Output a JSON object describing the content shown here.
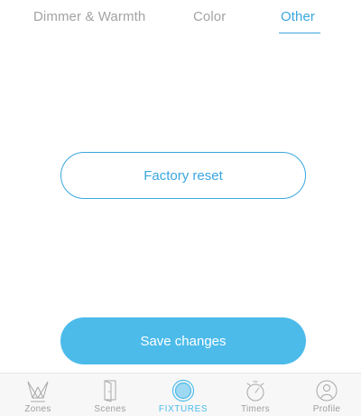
{
  "tabs": [
    {
      "label": "Dimmer & Warmth",
      "active": false
    },
    {
      "label": "Color",
      "active": false
    },
    {
      "label": "Other",
      "active": true
    }
  ],
  "actions": {
    "factory_reset_label": "Factory reset",
    "save_label": "Save changes"
  },
  "nav": {
    "items": [
      {
        "label": "Zones",
        "icon": "zones-icon",
        "active": false
      },
      {
        "label": "Scenes",
        "icon": "door-icon",
        "active": false
      },
      {
        "label": "FIXTURES",
        "icon": "fixture-icon",
        "active": true
      },
      {
        "label": "Timers",
        "icon": "stopwatch-icon",
        "active": false
      },
      {
        "label": "Profile",
        "icon": "profile-icon",
        "active": false
      }
    ]
  },
  "colors": {
    "accent": "#3aa6de",
    "button_fill": "#4cbbea",
    "inactive_text": "#a3a3a3",
    "nav_background": "#f7f7f7"
  }
}
